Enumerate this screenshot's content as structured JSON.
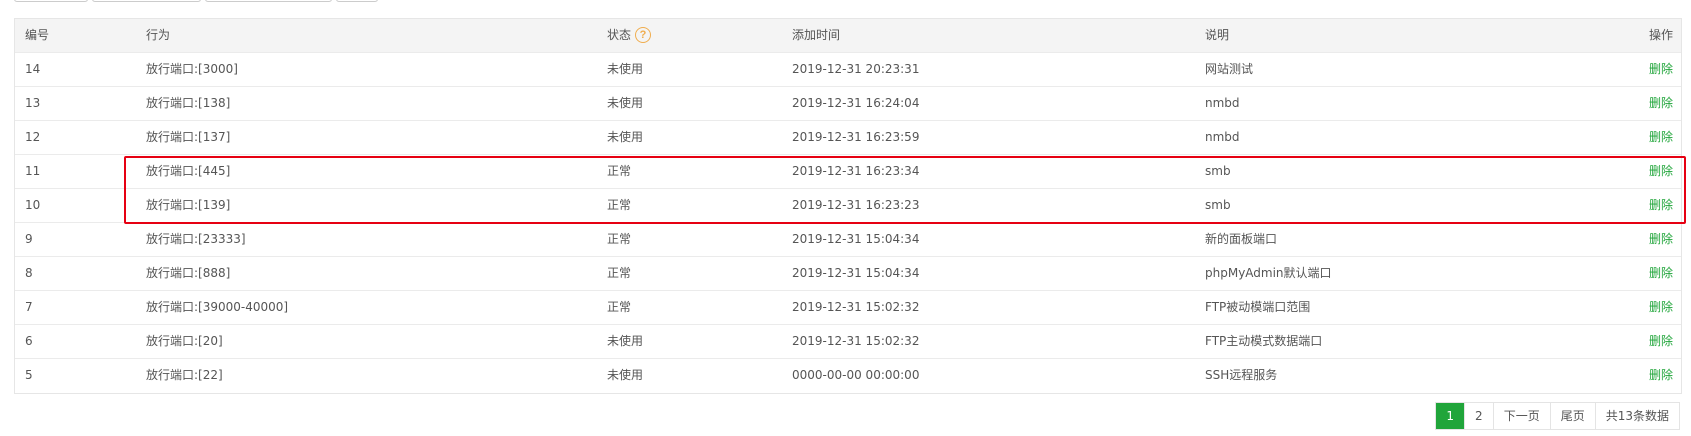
{
  "table": {
    "headers": {
      "id": "编号",
      "action": "行为",
      "status": "状态",
      "added_time": "添加时间",
      "description": "说明",
      "operation": "操作"
    },
    "rows": [
      {
        "id": "14",
        "action": "放行端口:[3000]",
        "status": "未使用",
        "added_time": "2019-12-31 20:23:31",
        "description": "网站测试",
        "operation": "删除"
      },
      {
        "id": "13",
        "action": "放行端口:[138]",
        "status": "未使用",
        "added_time": "2019-12-31 16:24:04",
        "description": "nmbd",
        "operation": "删除"
      },
      {
        "id": "12",
        "action": "放行端口:[137]",
        "status": "未使用",
        "added_time": "2019-12-31 16:23:59",
        "description": "nmbd",
        "operation": "删除"
      },
      {
        "id": "11",
        "action": "放行端口:[445]",
        "status": "正常",
        "added_time": "2019-12-31 16:23:34",
        "description": "smb",
        "operation": "删除"
      },
      {
        "id": "10",
        "action": "放行端口:[139]",
        "status": "正常",
        "added_time": "2019-12-31 16:23:23",
        "description": "smb",
        "operation": "删除"
      },
      {
        "id": "9",
        "action": "放行端口:[23333]",
        "status": "正常",
        "added_time": "2019-12-31 15:04:34",
        "description": "新的面板端口",
        "operation": "删除"
      },
      {
        "id": "8",
        "action": "放行端口:[888]",
        "status": "正常",
        "added_time": "2019-12-31 15:04:34",
        "description": "phpMyAdmin默认端口",
        "operation": "删除"
      },
      {
        "id": "7",
        "action": "放行端口:[39000-40000]",
        "status": "正常",
        "added_time": "2019-12-31 15:02:32",
        "description": "FTP被动模端口范围",
        "operation": "删除"
      },
      {
        "id": "6",
        "action": "放行端口:[20]",
        "status": "未使用",
        "added_time": "2019-12-31 15:02:32",
        "description": "FTP主动模式数据端口",
        "operation": "删除"
      },
      {
        "id": "5",
        "action": "放行端口:[22]",
        "status": "未使用",
        "added_time": "0000-00-00 00:00:00",
        "description": "SSH远程服务",
        "operation": "删除"
      }
    ]
  },
  "pagination": {
    "pages": [
      "1",
      "2"
    ],
    "current_page": "1",
    "next_label": "下一页",
    "last_label": "尾页",
    "total_label": "共13条数据"
  },
  "colors": {
    "accent": "#20a53a",
    "highlight": "#e60012",
    "help_icon": "#f0ad4e"
  },
  "icons": {
    "status_help": "question-circle-icon"
  },
  "help_icon_glyph": "?"
}
